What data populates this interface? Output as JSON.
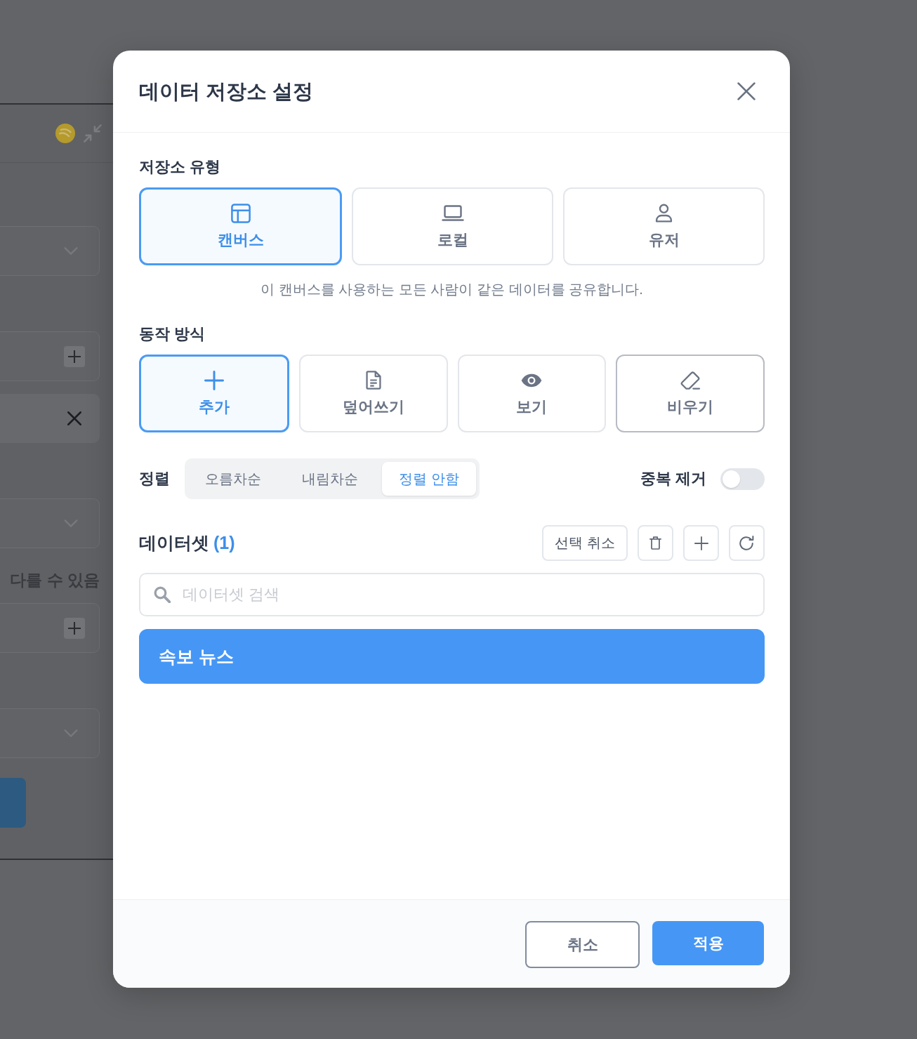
{
  "background_form": {
    "sections": [
      {
        "rows": [
          {
            "kind": "dropdown"
          }
        ]
      },
      {
        "rows": [
          {
            "kind": "add_field"
          },
          {
            "kind": "removable_row"
          }
        ]
      },
      {
        "rows": [
          {
            "kind": "dropdown"
          },
          {
            "kind": "note",
            "text": "다를 수 있음"
          },
          {
            "kind": "add_field"
          }
        ]
      },
      {
        "rows": [
          {
            "kind": "dropdown"
          },
          {
            "kind": "button"
          }
        ]
      }
    ]
  },
  "dialog": {
    "title": "데이터 저장소 설정",
    "storage_type": {
      "label": "저장소 유형",
      "options": [
        {
          "kind": "canvas",
          "label": "캔버스",
          "selected": true
        },
        {
          "kind": "local",
          "label": "로컬",
          "selected": false
        },
        {
          "kind": "user",
          "label": "유저",
          "selected": false
        }
      ],
      "description": "이 캔버스를 사용하는 모든 사람이 같은 데이터를 공유합니다."
    },
    "mode": {
      "label": "동작 방식",
      "options": [
        {
          "kind": "add",
          "label": "추가",
          "selected": true,
          "hovered": false
        },
        {
          "kind": "overwrite",
          "label": "덮어쓰기",
          "selected": false,
          "hovered": false
        },
        {
          "kind": "view",
          "label": "보기",
          "selected": false,
          "hovered": false
        },
        {
          "kind": "clear",
          "label": "비우기",
          "selected": false,
          "hovered": true
        }
      ]
    },
    "sort": {
      "label": "정렬",
      "options": [
        {
          "label": "오름차순",
          "selected": false
        },
        {
          "label": "내림차순",
          "selected": false
        },
        {
          "label": "정렬 안함",
          "selected": true
        }
      ]
    },
    "dedupe": {
      "label": "중복 제거",
      "on": false
    },
    "datasets": {
      "title": "데이터셋",
      "count": "(1)",
      "actions": [
        {
          "kind": "text",
          "label": "선택 취소"
        },
        {
          "kind": "delete"
        },
        {
          "kind": "add"
        },
        {
          "kind": "refresh"
        }
      ],
      "search": {
        "placeholder": "데이터셋 검색"
      },
      "items": [
        {
          "label": "속보 뉴스",
          "selected": true
        }
      ]
    },
    "footer": {
      "buttons": [
        {
          "kind": "secondary",
          "label": "취소"
        },
        {
          "kind": "primary",
          "label": "적용"
        }
      ]
    }
  }
}
